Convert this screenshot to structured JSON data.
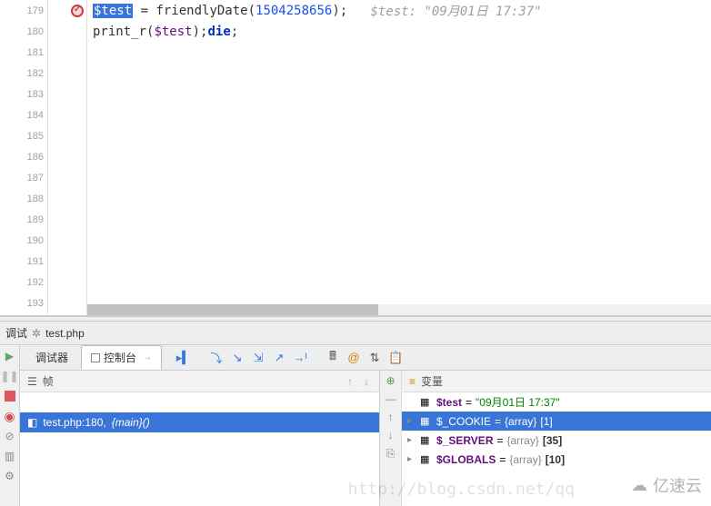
{
  "gutter": {
    "lines": [
      "179",
      "180",
      "181",
      "182",
      "183",
      "184",
      "185",
      "186",
      "187",
      "188",
      "189",
      "190",
      "191",
      "192",
      "193"
    ],
    "breakpoint_line": "179"
  },
  "code": {
    "line1": {
      "sel": "$test",
      "rest1": " = friendlyDate(",
      "num": "1504258656",
      "rest2": ");   ",
      "comment": "$test: \"09月01日 17:37\""
    },
    "line2": {
      "p1": "print_r",
      "p2": "(",
      "var": "$test",
      "p3": ");",
      "kw": "die",
      "p4": ";"
    }
  },
  "debug_tab": {
    "label": "调试",
    "file": "test.php"
  },
  "tabs": {
    "debugger": "调试器",
    "console": "控制台"
  },
  "frames_panel": {
    "title": "帧",
    "row": {
      "file": "test.php:180,",
      "main": "{main}()"
    }
  },
  "vars_panel": {
    "title": "变量",
    "rows": [
      {
        "name": "$test",
        "eq": " = ",
        "val": "\"09月01日 17:37\"",
        "kind": "str"
      },
      {
        "name": "$_COOKIE",
        "eq": " = ",
        "type": "{array}",
        "cnt": "[1]",
        "sel": true,
        "expandable": true
      },
      {
        "name": "$_SERVER",
        "eq": " = ",
        "type": "{array}",
        "cnt": "[35]",
        "expandable": true
      },
      {
        "name": "$GLOBALS",
        "eq": " = ",
        "type": "{array}",
        "cnt": "[10]",
        "expandable": true
      }
    ]
  },
  "watermark": {
    "text": "亿速云",
    "url": "http://blog.csdn.net/qq"
  }
}
